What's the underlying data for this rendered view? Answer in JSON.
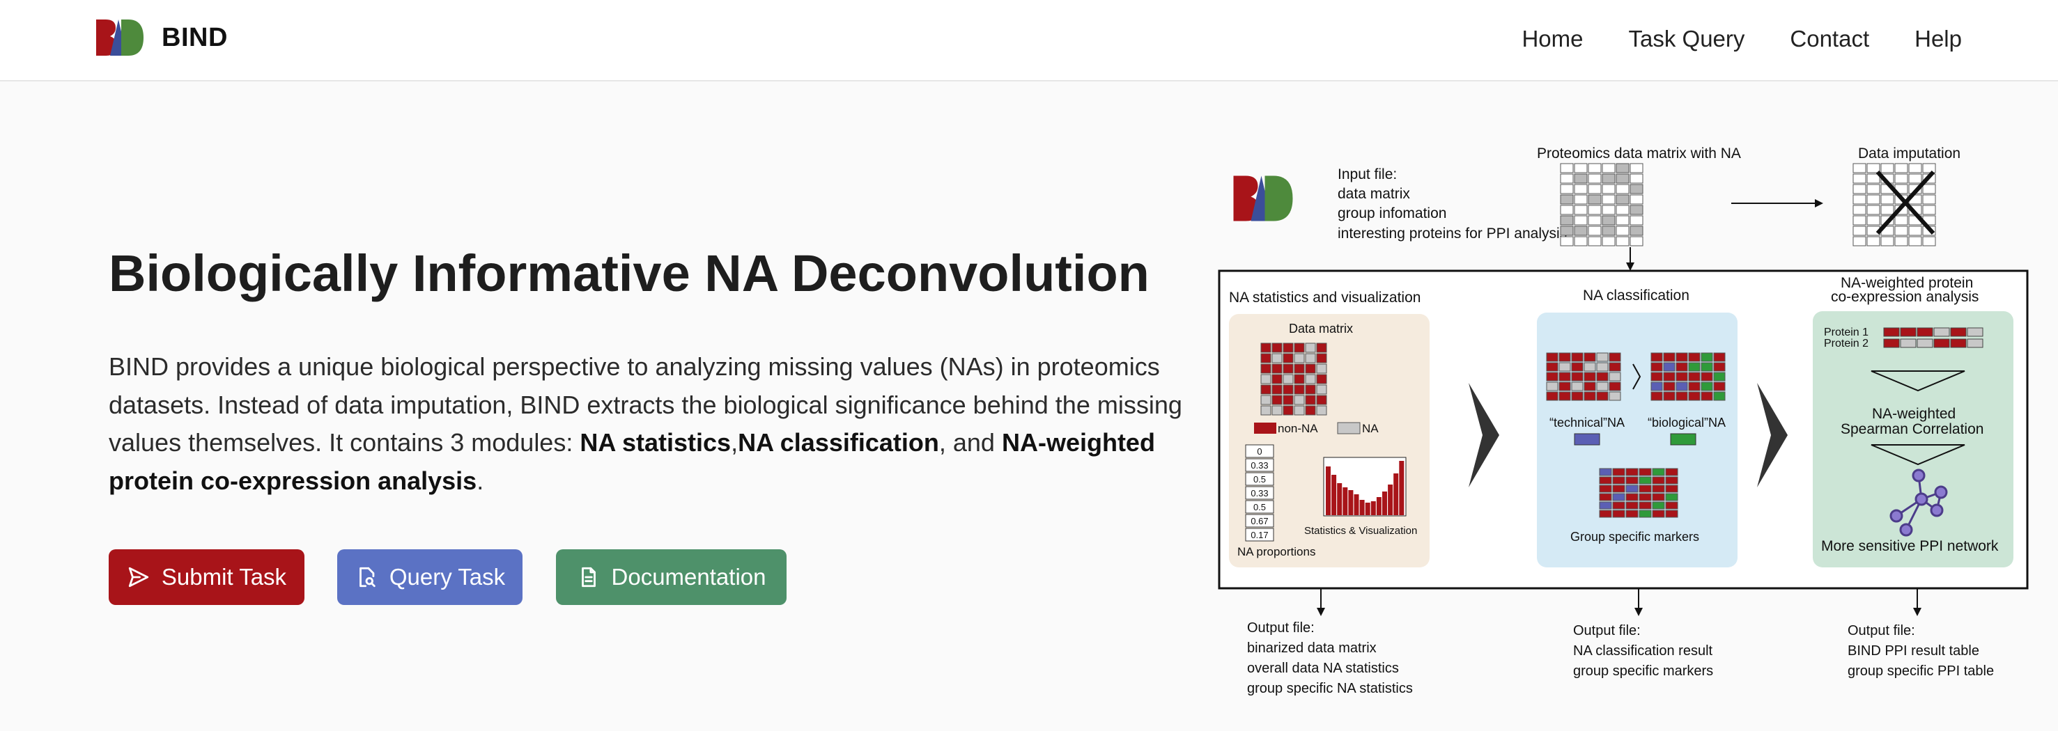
{
  "app": {
    "brand": "BIND"
  },
  "nav": {
    "home": "Home",
    "task_query": "Task Query",
    "contact": "Contact",
    "help": "Help"
  },
  "hero": {
    "title": "Biologically Informative NA Deconvolution",
    "desc_intro": "BIND provides a unique biological perspective to analyzing missing values (NAs) in proteomics datasets. Instead of data imputation, BIND extracts the biological significance behind the missing values themselves. It contains 3 modules: ",
    "module1": "NA statistics",
    "sep1": ",",
    "module2": "NA classification",
    "sep2": ", and ",
    "module3": "NA-weighted protein co-expression analysis",
    "desc_end": "."
  },
  "buttons": {
    "submit": "Submit Task",
    "query": "Query Task",
    "documentation": "Documentation"
  },
  "icons": {
    "submit": "send-icon",
    "query": "file-search-icon",
    "documentation": "file-text-icon"
  },
  "colors": {
    "brand_red": "#a81419",
    "brand_blue": "#3b4e9a",
    "brand_green": "#4e8a3c",
    "submit": "#a81419",
    "query": "#5b72c4",
    "documentation": "#4e916a"
  },
  "diagram": {
    "input_label": "Input file:",
    "input_lines": [
      "data matrix",
      "group infomation",
      "interesting proteins for PPI analysis"
    ],
    "proteomics_title": "Proteomics data matrix with NA",
    "imputation_title": "Data imputation",
    "m1_title": "NA statistics and visualization",
    "m1_data_matrix": "Data matrix",
    "m1_legend_nonna": "non-NA",
    "m1_legend_na": "NA",
    "m1_proportions": [
      "0",
      "0.33",
      "0.5",
      "0.33",
      "0.5",
      "0.67",
      "0.17"
    ],
    "m1_stats": "Statistics & Visualization",
    "m1_na_proportions": "NA proportions",
    "m2_title": "NA classification",
    "m2_technical": "“technical”NA",
    "m2_biological": "“biological”NA",
    "m2_markers": "Group specific markers",
    "m3_title_1": "NA-weighted protein",
    "m3_title_2": "co-expression analysis",
    "m3_protein1": "Protein 1",
    "m3_protein2": "Protein 2",
    "m3_corr_1": "NA-weighted",
    "m3_corr_2": "Spearman Correlation",
    "m3_network": "More sensitive PPI network",
    "out1": [
      "Output file:",
      "binarized data matrix",
      "overall data NA statistics",
      "group specific NA statistics"
    ],
    "out2": [
      "Output file:",
      "NA classification result",
      "group specific markers"
    ],
    "out3": [
      "Output file:",
      "BIND PPI result table",
      "group specific PPI table"
    ]
  }
}
